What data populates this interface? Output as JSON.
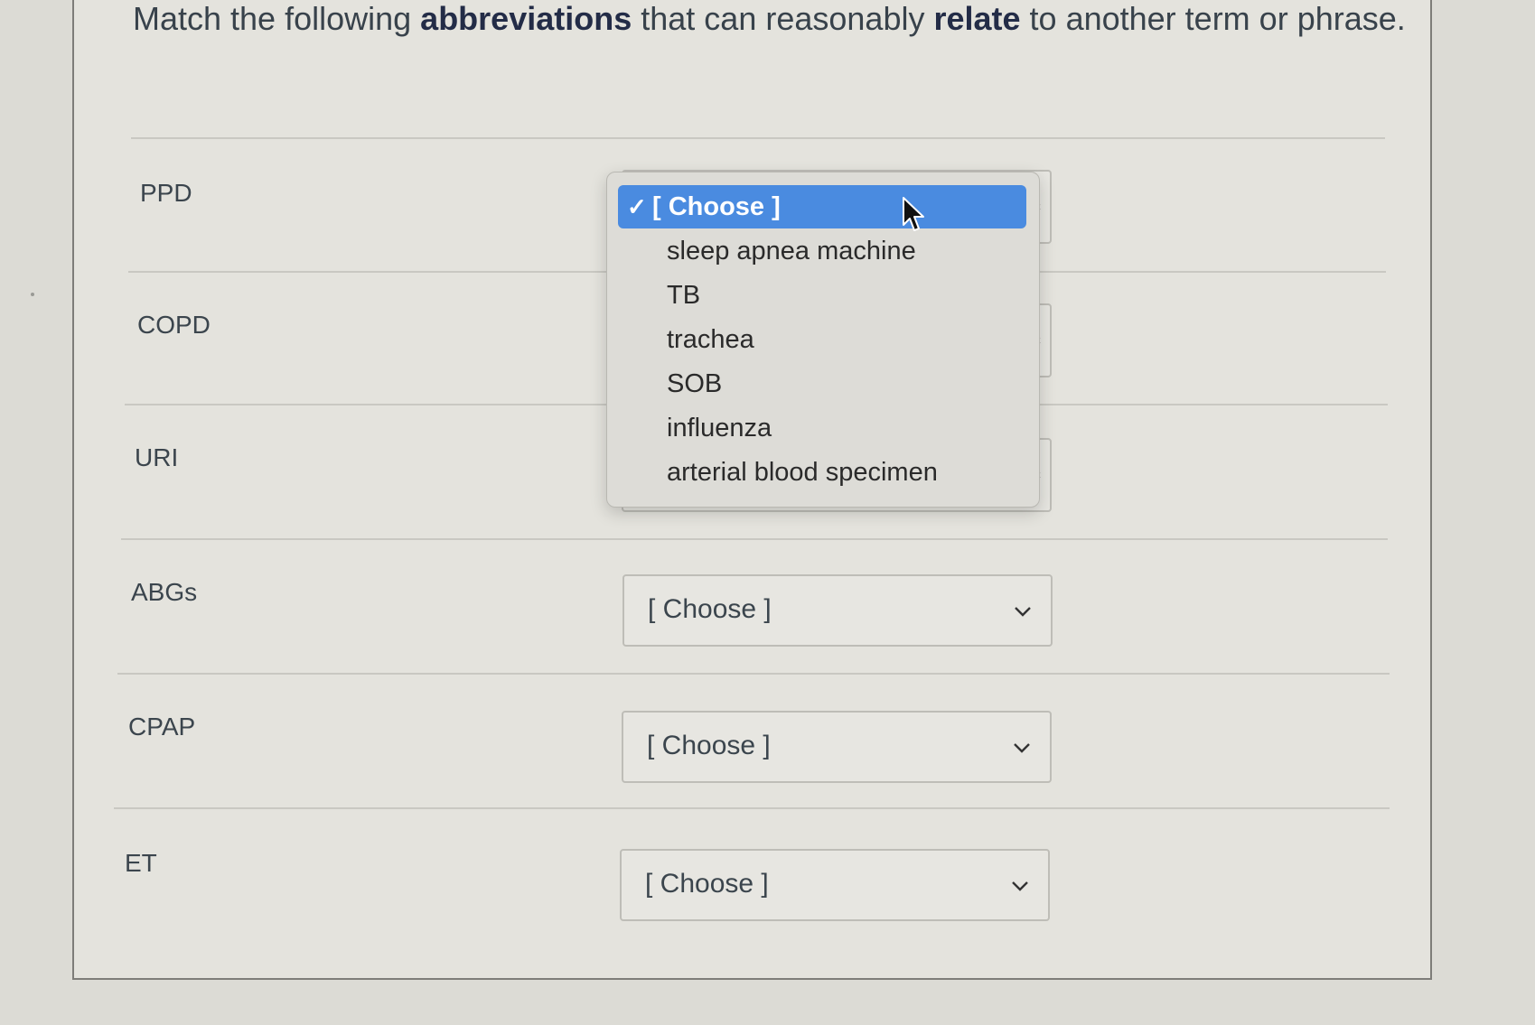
{
  "question": {
    "text_before": "Match the following ",
    "bold1": "abbreviations",
    "text_mid": " that can reasonably ",
    "bold2": "relate",
    "text_after": " to another term or phrase."
  },
  "rows": [
    {
      "label": "PPD",
      "value": "[ Choose ]"
    },
    {
      "label": "COPD",
      "value": "[ Choose ]"
    },
    {
      "label": "URI",
      "value": "[ Choose ]"
    },
    {
      "label": "ABGs",
      "value": "[ Choose ]"
    },
    {
      "label": "CPAP",
      "value": "[ Choose ]"
    },
    {
      "label": "ET",
      "value": "[ Choose ]"
    }
  ],
  "dropdown": {
    "check_glyph": "✓",
    "options": [
      "[ Choose ]",
      "sleep apnea machine",
      "TB",
      "trachea",
      "SOB",
      "influenza",
      "arterial blood specimen"
    ]
  },
  "icons": {
    "chevron": "chevron-down-icon",
    "cursor": "mouse-pointer-icon",
    "check": "checkmark-icon"
  },
  "colors": {
    "highlight": "#4a8be0",
    "bold_text": "#232c47"
  }
}
